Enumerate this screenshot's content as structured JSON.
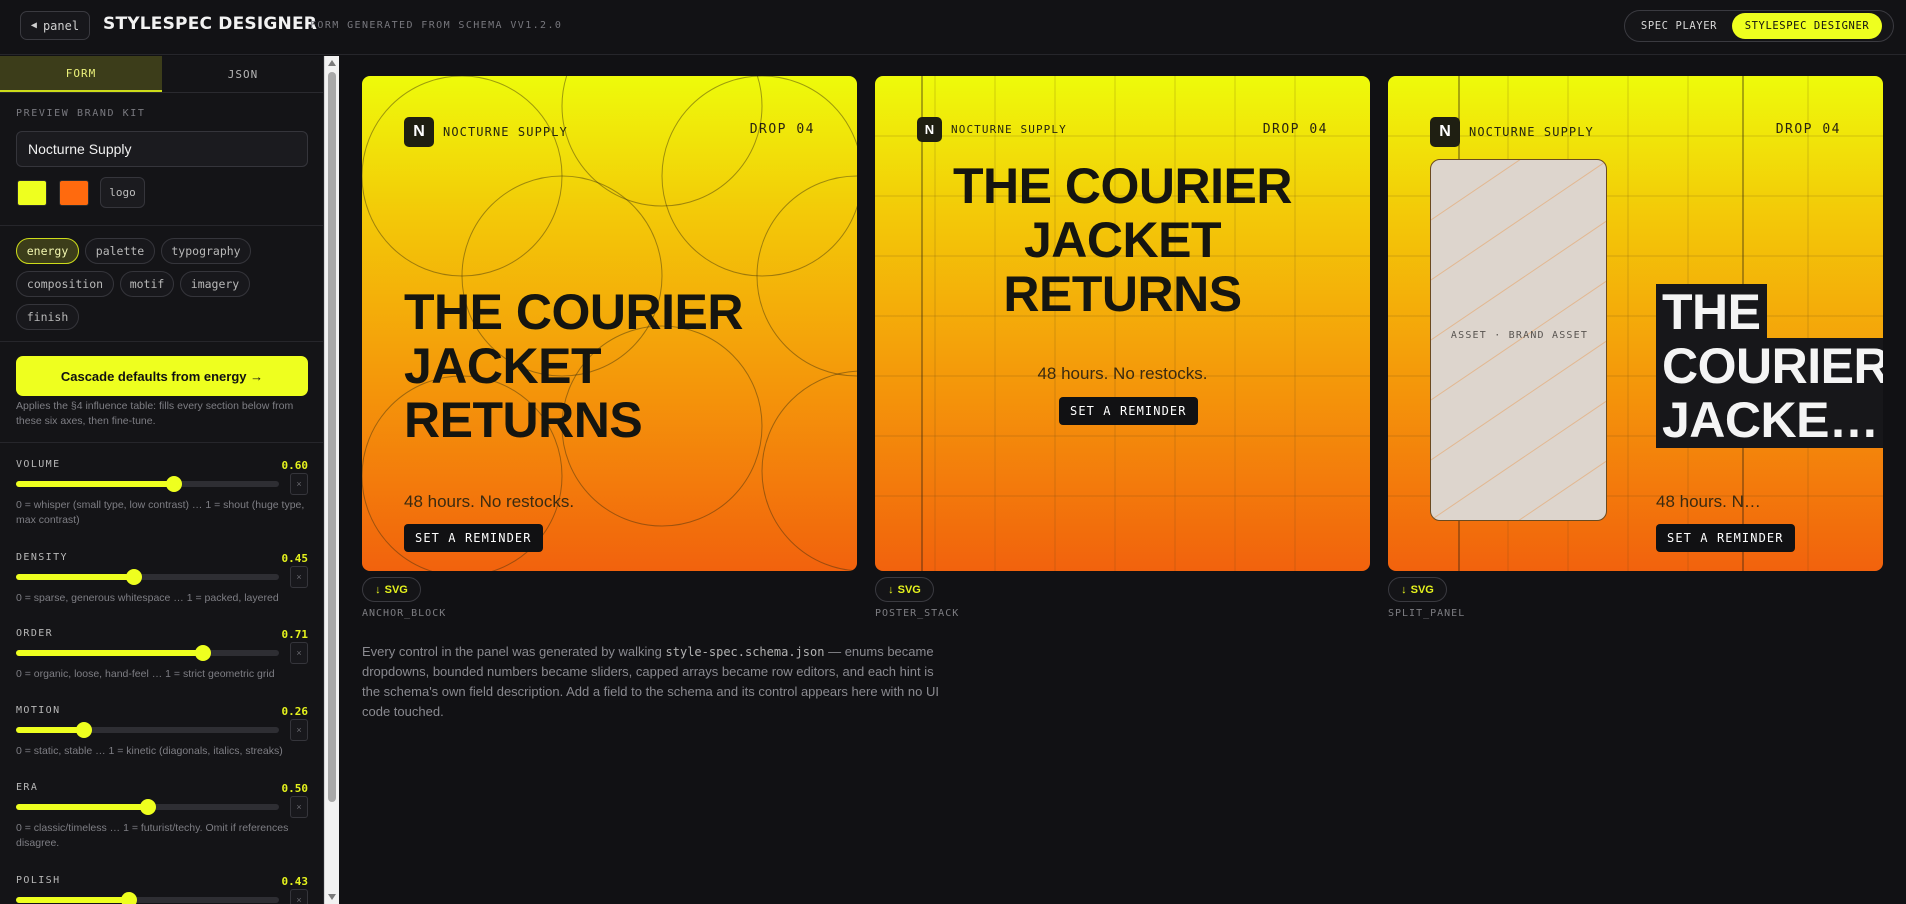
{
  "topbar": {
    "back_label": "panel",
    "app_title": "STYLESPEC DESIGNER",
    "app_subtitle": "FORM GENERATED FROM SCHEMA VV1.2.0",
    "mode_spec_player": "SPEC PLAYER",
    "mode_designer": "STYLESPEC DESIGNER"
  },
  "sidebar": {
    "tabs": [
      {
        "label": "FORM",
        "active": true
      },
      {
        "label": "JSON",
        "active": false
      }
    ],
    "brand_kit_label": "PREVIEW BRAND KIT",
    "brand_name": "Nocturne Supply",
    "brand_colors": [
      "#eeff1f",
      "#ff6a0e"
    ],
    "logo_label": "logo",
    "chips": [
      {
        "label": "energy",
        "active": true
      },
      {
        "label": "palette",
        "active": false
      },
      {
        "label": "typography",
        "active": false
      },
      {
        "label": "composition",
        "active": false
      },
      {
        "label": "motif",
        "active": false
      },
      {
        "label": "imagery",
        "active": false
      },
      {
        "label": "finish",
        "active": false
      }
    ],
    "cascade_button": "Cascade defaults from energy →",
    "cascade_help": "Applies the §4 influence table: fills every section below from these six axes, then fine-tune.",
    "reset_glyph": "×",
    "sliders": [
      {
        "name": "VOLUME",
        "value": "0.60",
        "fraction": 0.6,
        "hint": "0 = whisper (small type, low contrast) … 1 = shout (huge type, max contrast)"
      },
      {
        "name": "DENSITY",
        "value": "0.45",
        "fraction": 0.45,
        "hint": "0 = sparse, generous whitespace … 1 = packed, layered"
      },
      {
        "name": "ORDER",
        "value": "0.71",
        "fraction": 0.71,
        "hint": "0 = organic, loose, hand-feel … 1 = strict geometric grid"
      },
      {
        "name": "MOTION",
        "value": "0.26",
        "fraction": 0.26,
        "hint": "0 = static, stable … 1 = kinetic (diagonals, italics, streaks)"
      },
      {
        "name": "ERA",
        "value": "0.50",
        "fraction": 0.5,
        "hint": "0 = classic/timeless … 1 = futurist/techy. Omit if references disagree."
      },
      {
        "name": "POLISH",
        "value": "0.43",
        "fraction": 0.43,
        "hint": ""
      }
    ]
  },
  "posters": [
    {
      "variant": "ANCHOR_BLOCK",
      "brand": "NOCTURNE SUPPLY",
      "mark": "N",
      "drop": "DROP 04",
      "headline": [
        "THE COURIER",
        "JACKET",
        "RETURNS"
      ],
      "subline": "48 hours. No restocks.",
      "cta": "SET A REMINDER",
      "download": "SVG"
    },
    {
      "variant": "POSTER_STACK",
      "brand": "NOCTURNE SUPPLY",
      "mark": "N",
      "drop": "DROP 04",
      "headline": [
        "THE COURIER",
        "JACKET",
        "RETURNS"
      ],
      "subline": "48 hours. No restocks.",
      "cta": "SET A REMINDER",
      "download": "SVG"
    },
    {
      "variant": "SPLIT_PANEL",
      "brand": "NOCTURNE SUPPLY",
      "mark": "N",
      "drop": "DROP 04",
      "headline": [
        "THE",
        "COURIER",
        "JACKE…"
      ],
      "asset_label": "ASSET · BRAND ASSET",
      "subline": "48 hours. N…",
      "cta": "SET A REMINDER",
      "download": "SVG"
    }
  ],
  "footnote": {
    "before": "Every control in the panel was generated by walking ",
    "code": "style-spec.schema.json",
    "after": " — enums became dropdowns, bounded numbers became sliders, capped arrays became row editors, and each hint is the schema's own field description. Add a field to the schema and its control appears here with no UI code touched."
  },
  "colors": {
    "accent": "#eeff1f",
    "orange": "#ff6a0e",
    "bg": "#111114"
  }
}
